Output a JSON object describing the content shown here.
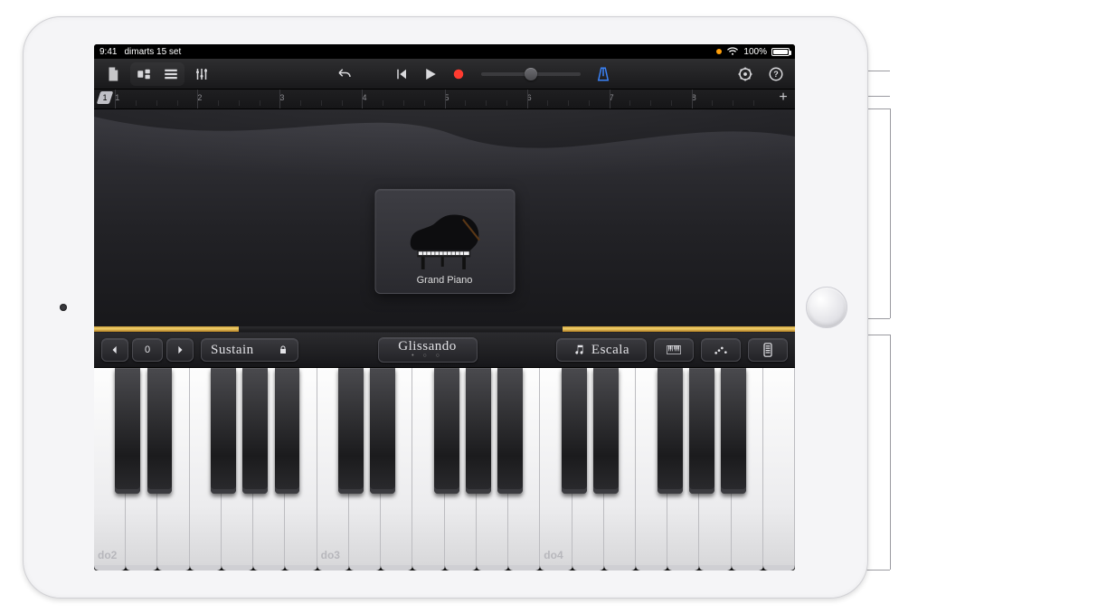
{
  "status": {
    "time": "9:41",
    "date": "dimarts 15 set",
    "battery_pct": "100%"
  },
  "toolbar": {
    "my_songs": "my-songs",
    "browser": "browser",
    "tracks": "tracks-view",
    "controls": "track-controls",
    "undo": "undo",
    "rewind": "go-to-beginning",
    "play": "play",
    "record": "record",
    "volume": "master-volume",
    "metronome": "metronome",
    "settings": "settings",
    "help": "help"
  },
  "ruler": {
    "bars": [
      1,
      2,
      3,
      4,
      5,
      6,
      7,
      8
    ],
    "add": "+"
  },
  "instrument": {
    "name": "Grand Piano"
  },
  "kbcontrols": {
    "octave_down": "‹",
    "octave_value": "0",
    "octave_up": "›",
    "sustain": "Sustain",
    "glissando": "Glissando",
    "scale": "Escala",
    "keyboard_layout": "keyboard-layout",
    "arpeggiator": "arpeggiator",
    "keyboard_switch": "keyboard-switch"
  },
  "keyboard": {
    "white_count": 22,
    "labels": {
      "0": "do2",
      "7": "do3",
      "14": "do4"
    },
    "black_positions_pct": [
      3.0,
      7.55,
      16.65,
      21.2,
      25.75,
      34.85,
      39.4,
      48.5,
      53.05,
      57.6,
      66.7,
      71.25,
      80.35,
      84.9,
      89.45,
      98.4
    ]
  }
}
